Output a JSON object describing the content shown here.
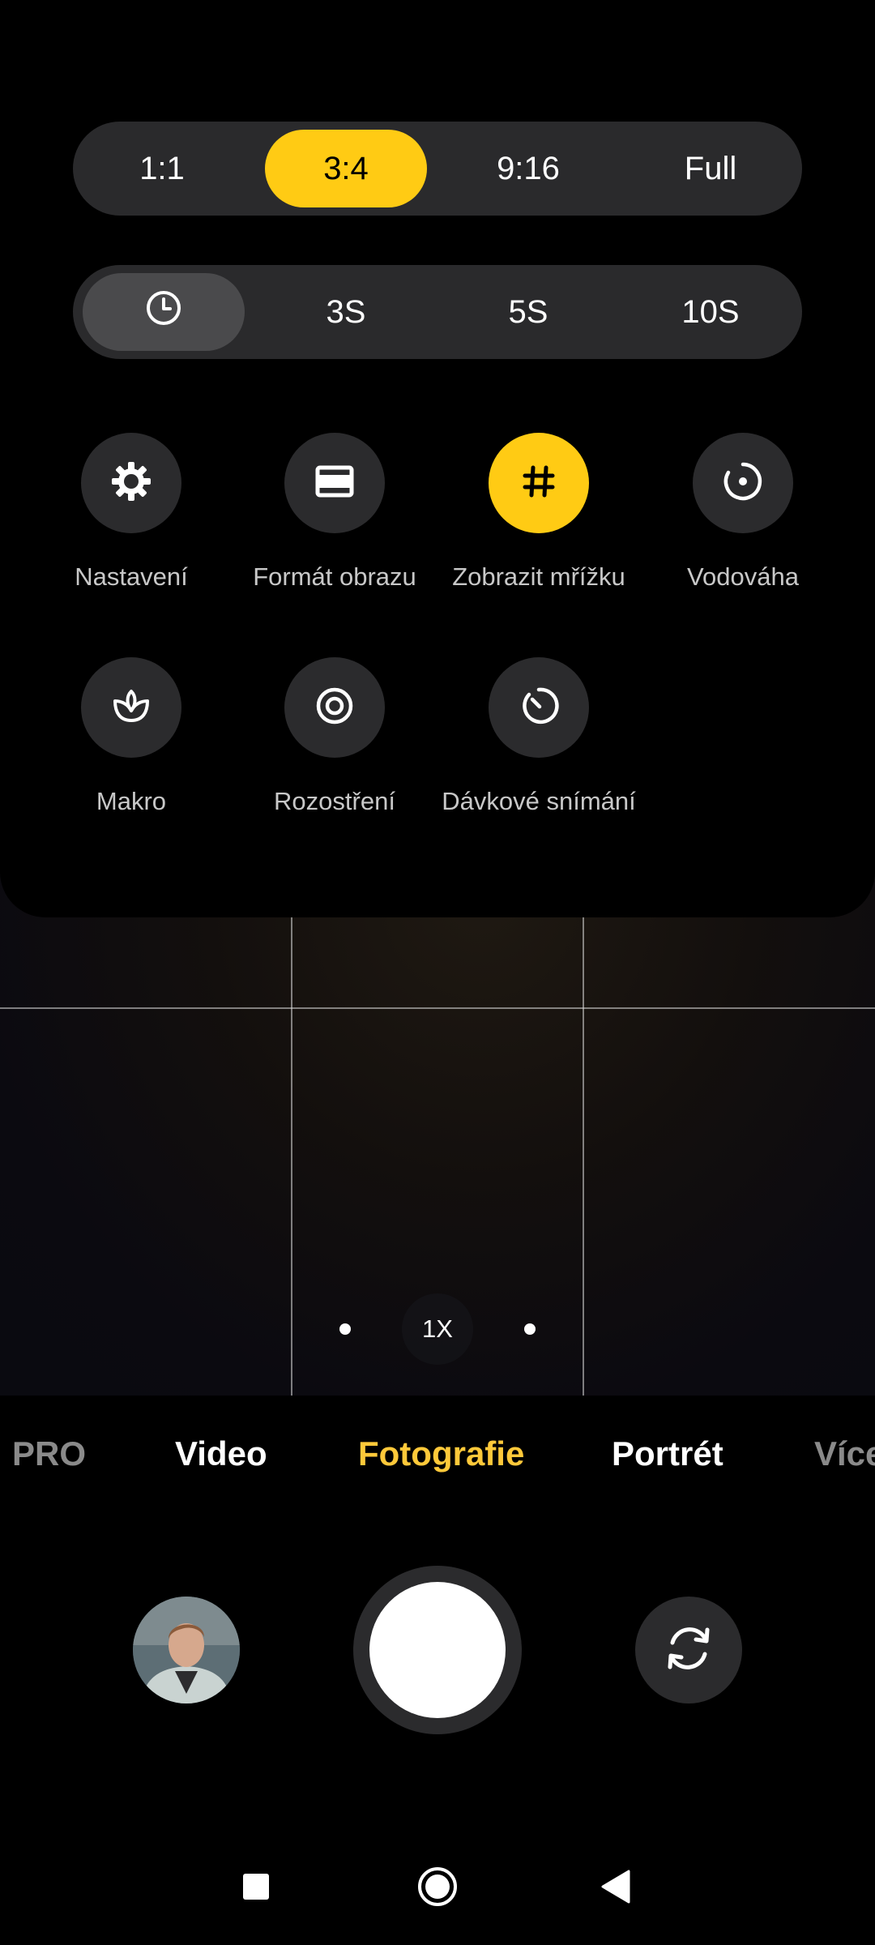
{
  "aspect_ratio": {
    "options": [
      "1:1",
      "3:4",
      "9:16",
      "Full"
    ],
    "selected": "3:4"
  },
  "timer": {
    "icon": "clock-icon",
    "options": [
      "3S",
      "5S",
      "10S"
    ],
    "selected": "off"
  },
  "quick_settings": [
    {
      "label": "Nastavení",
      "icon": "gear-icon",
      "active": false
    },
    {
      "label": "Formát obrazu",
      "icon": "aspect-frame-icon",
      "active": false
    },
    {
      "label": "Zobrazit mřížku",
      "icon": "grid-hash-icon",
      "active": true
    },
    {
      "label": "Vodováha",
      "icon": "level-icon",
      "active": false
    },
    {
      "label": "Makro",
      "icon": "flower-icon",
      "active": false
    },
    {
      "label": "Rozostření",
      "icon": "blur-icon",
      "active": false
    },
    {
      "label": "Dávkové snímání",
      "icon": "burst-icon",
      "active": false
    }
  ],
  "viewfinder": {
    "zoom_label": "1X"
  },
  "modes": [
    {
      "label": "PRO",
      "state": "faded"
    },
    {
      "label": "Video",
      "state": "normal"
    },
    {
      "label": "Fotografie",
      "state": "active"
    },
    {
      "label": "Portrét",
      "state": "normal"
    },
    {
      "label": "Více",
      "state": "faded"
    }
  ],
  "colors": {
    "accent": "#ffcb14",
    "active_mode": "#ffc93a",
    "panel_background": "#000000",
    "button_background": "#2b2b2d"
  }
}
